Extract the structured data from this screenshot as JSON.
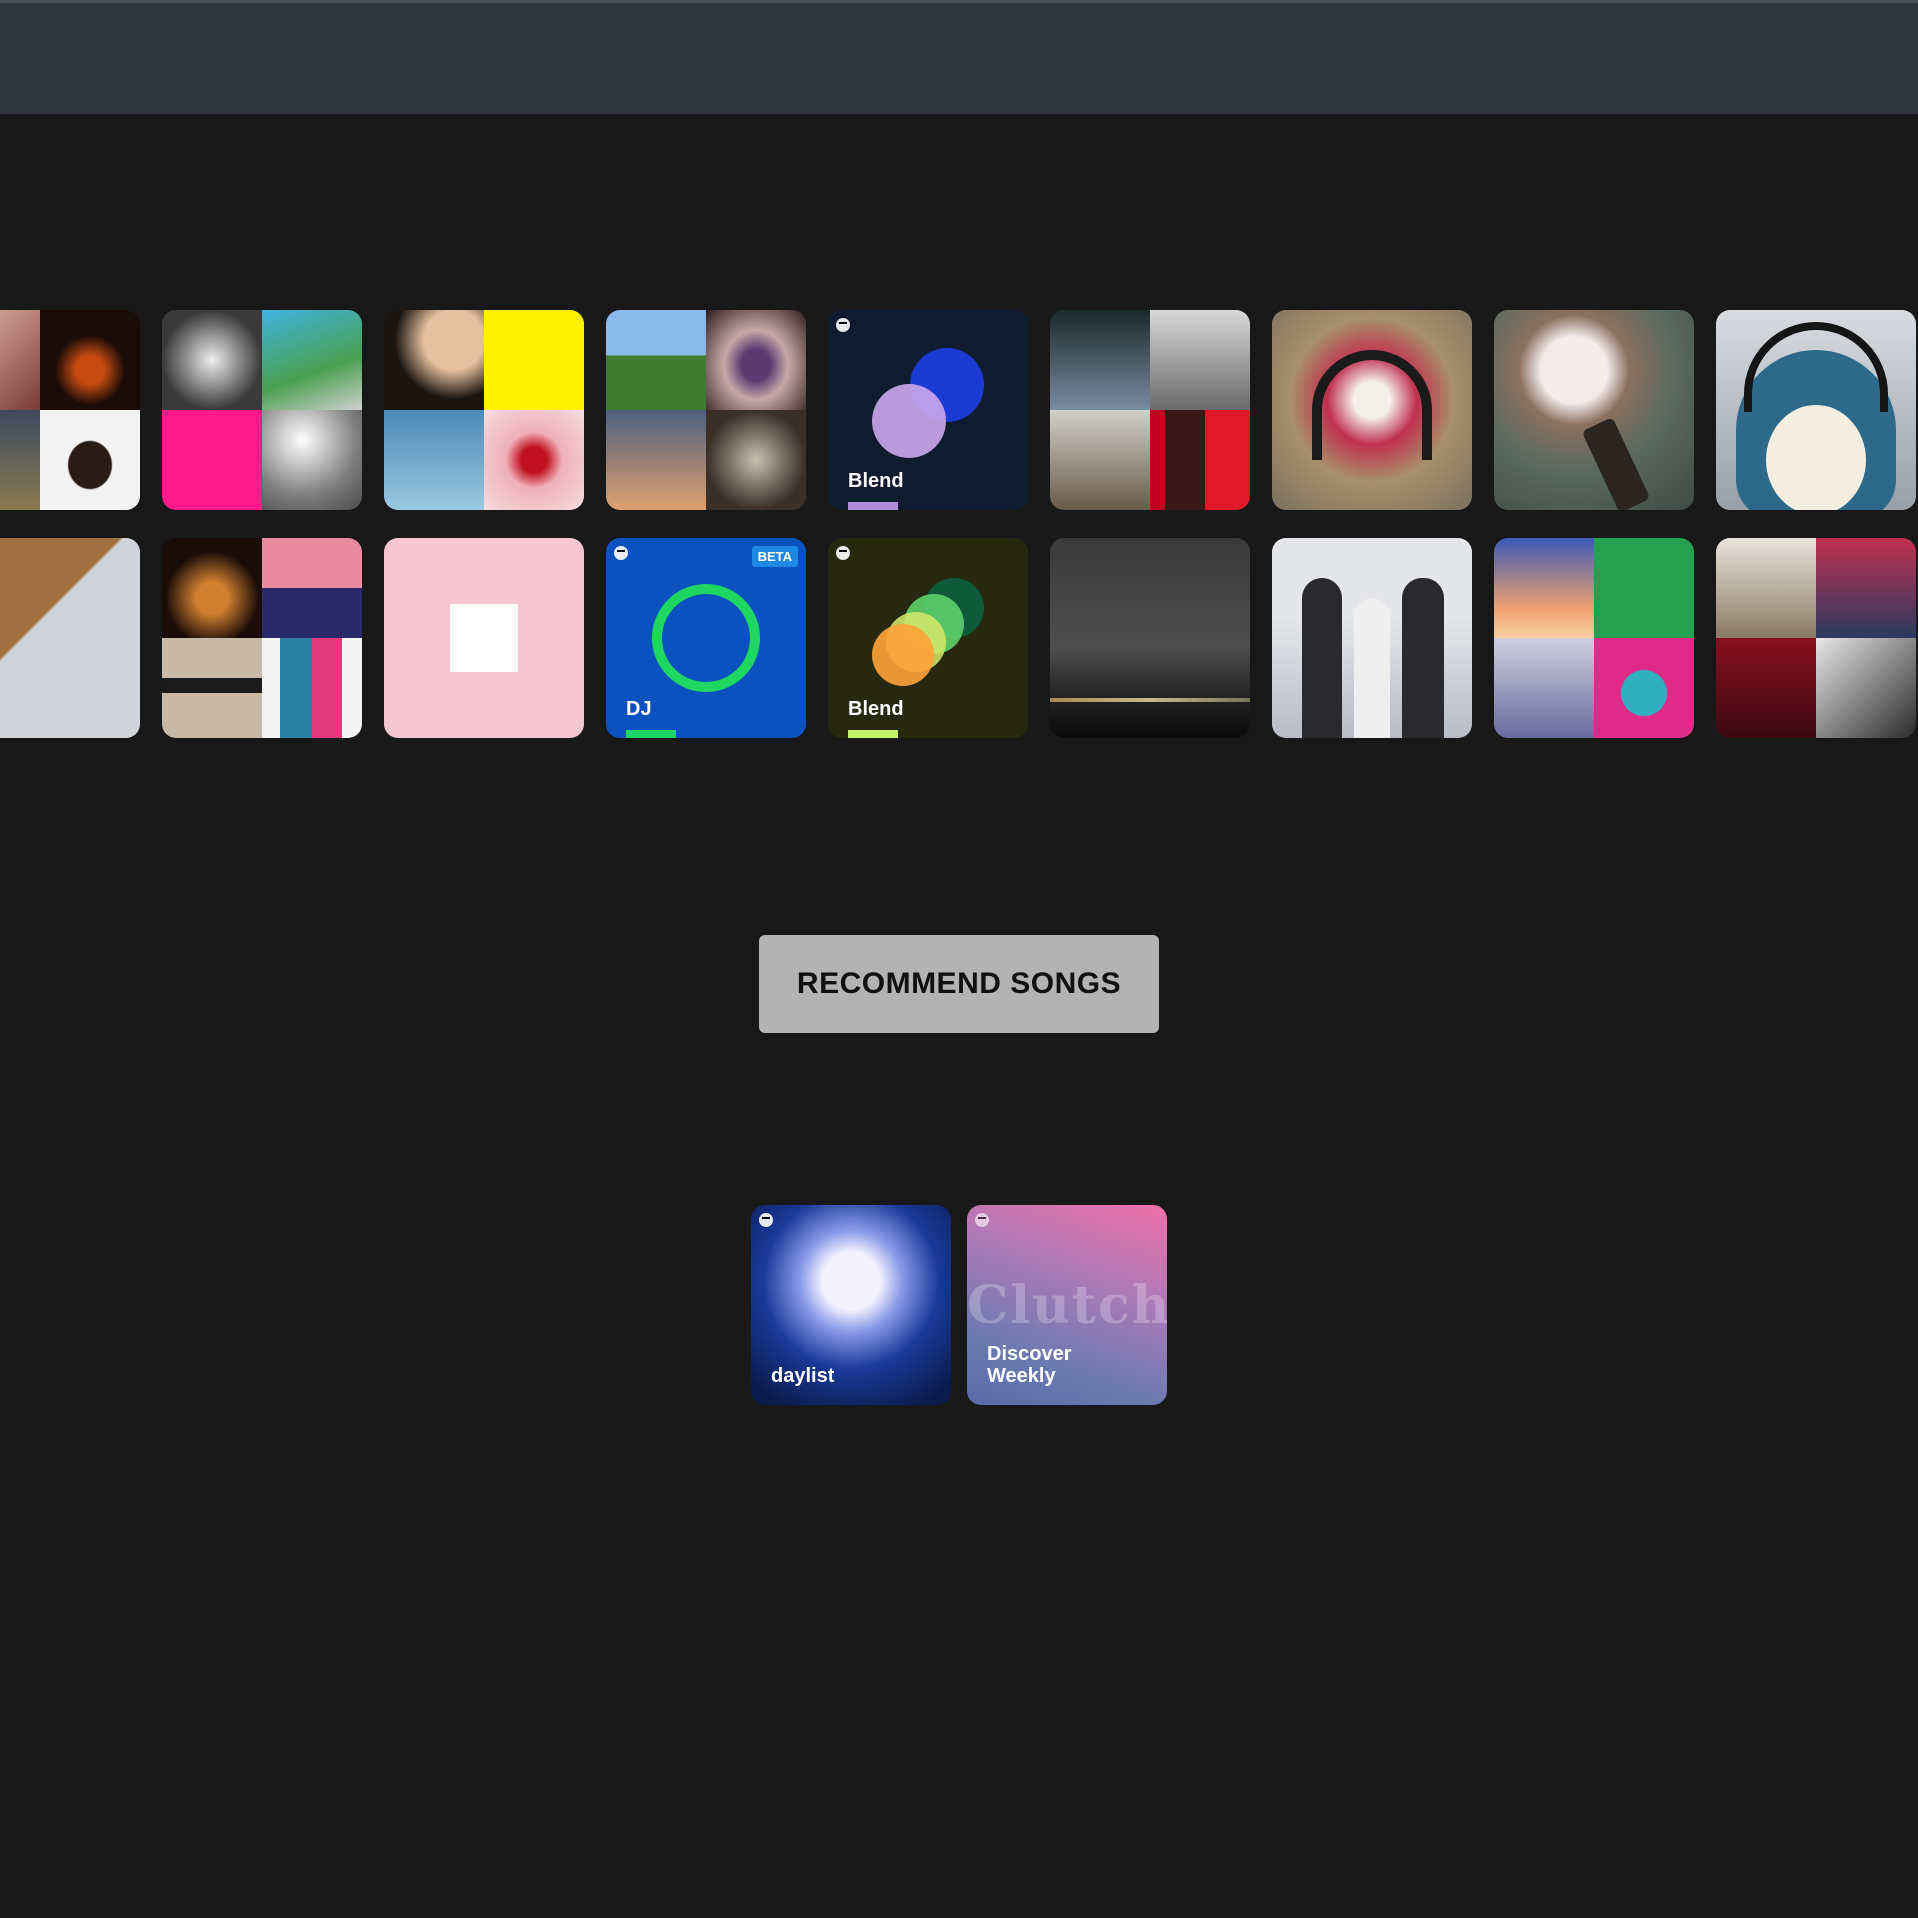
{
  "top_bar": {},
  "tiles": [
    {
      "label": "Blend",
      "accent": "#b08fd8"
    },
    {
      "label": "DJ",
      "badge": "BETA",
      "accent": "#1ed760"
    },
    {
      "label": "Blend",
      "accent": "#c6f36b"
    }
  ],
  "action": {
    "recommend_label": "RECOMMEND SONGS"
  },
  "recommendations": [
    {
      "label": "daylist"
    },
    {
      "label": "Discover Weekly",
      "line1": "Discover",
      "line2": "Weekly",
      "art_text": "Clutch"
    }
  ],
  "colors": {
    "background": "#181818",
    "top_bar": "#31353d",
    "button": "#b3b3b3",
    "blend_bg": "#0f1b2e",
    "dj_bg": "#0b52c0",
    "blend2_bg": "#26290f"
  }
}
